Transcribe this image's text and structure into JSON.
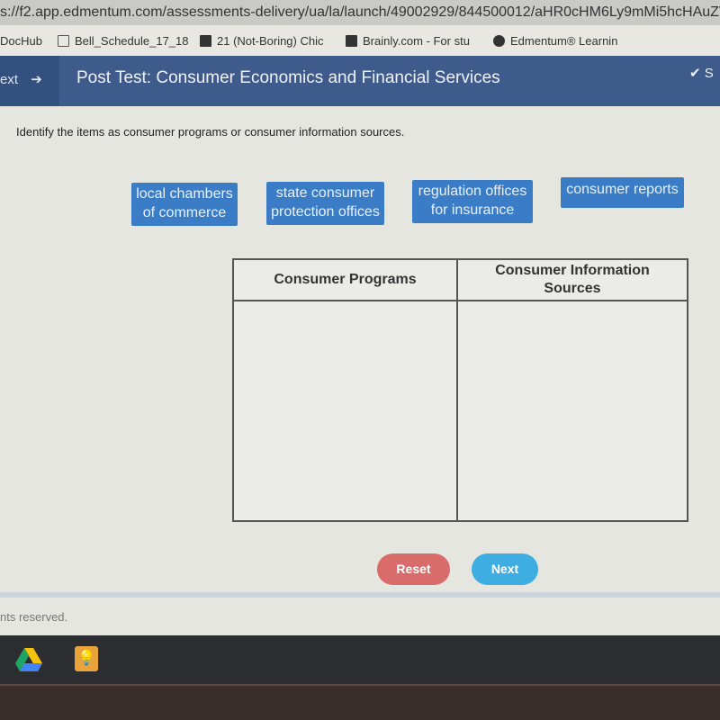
{
  "browser": {
    "url": "s://f2.app.edmentum.com/assessments-delivery/ua/la/launch/49002929/844500012/aHR0cHM6Ly9mMi5hcHAuZWRtZW",
    "bookmarks": [
      "DocHub",
      "Bell_Schedule_17_18",
      "21 (Not-Boring) Chic",
      "Brainly.com - For stu",
      "Edmentum® Learnin"
    ]
  },
  "header": {
    "nav_label": "ext",
    "title": "Post Test: Consumer Economics and Financial Services",
    "save_label": "S"
  },
  "question": {
    "instruction": "Identify the items as consumer programs or consumer information sources.",
    "tiles": [
      "local chambers of commerce",
      "state consumer protection offices",
      "regulation offices for insurance",
      "consumer reports"
    ],
    "columns": [
      "Consumer Programs",
      "Consumer Information Sources"
    ]
  },
  "buttons": {
    "reset": "Reset",
    "next": "Next"
  },
  "footer": {
    "text": "nts reserved."
  },
  "colors": {
    "header": "#3f5b8c",
    "tile": "#3a7dc6",
    "reset": "#d96b6b",
    "next": "#3eaee2"
  }
}
